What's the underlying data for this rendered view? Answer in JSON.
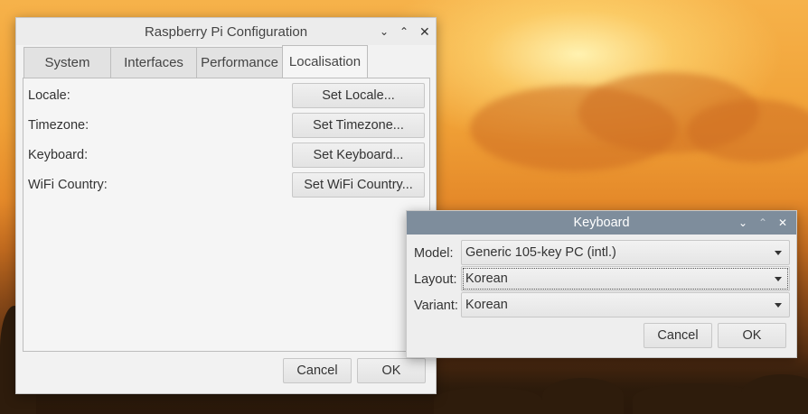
{
  "config_window": {
    "title": "Raspberry Pi Configuration",
    "tabs": [
      {
        "label": "System",
        "active": false
      },
      {
        "label": "Interfaces",
        "active": false
      },
      {
        "label": "Performance",
        "active": false
      },
      {
        "label": "Localisation",
        "active": true
      }
    ],
    "rows": [
      {
        "label": "Locale:",
        "button": "Set Locale..."
      },
      {
        "label": "Timezone:",
        "button": "Set Timezone..."
      },
      {
        "label": "Keyboard:",
        "button": "Set Keyboard..."
      },
      {
        "label": "WiFi Country:",
        "button": "Set WiFi Country..."
      }
    ],
    "cancel_label": "Cancel",
    "ok_label": "OK"
  },
  "keyboard_dialog": {
    "title": "Keyboard",
    "model": {
      "label": "Model:",
      "value": "Generic 105-key PC (intl.)"
    },
    "layout": {
      "label": "Layout:",
      "value": "Korean"
    },
    "variant": {
      "label": "Variant:",
      "value": "Korean"
    },
    "cancel_label": "Cancel",
    "ok_label": "OK"
  },
  "icons": {
    "minimize": "chevron-down-icon",
    "maximize": "chevron-up-icon",
    "close": "close-icon",
    "dropdown": "triangle-down-icon"
  },
  "colors": {
    "dialog_titlebar": "#7e8d9c",
    "window_bg": "#f2f2f2"
  }
}
